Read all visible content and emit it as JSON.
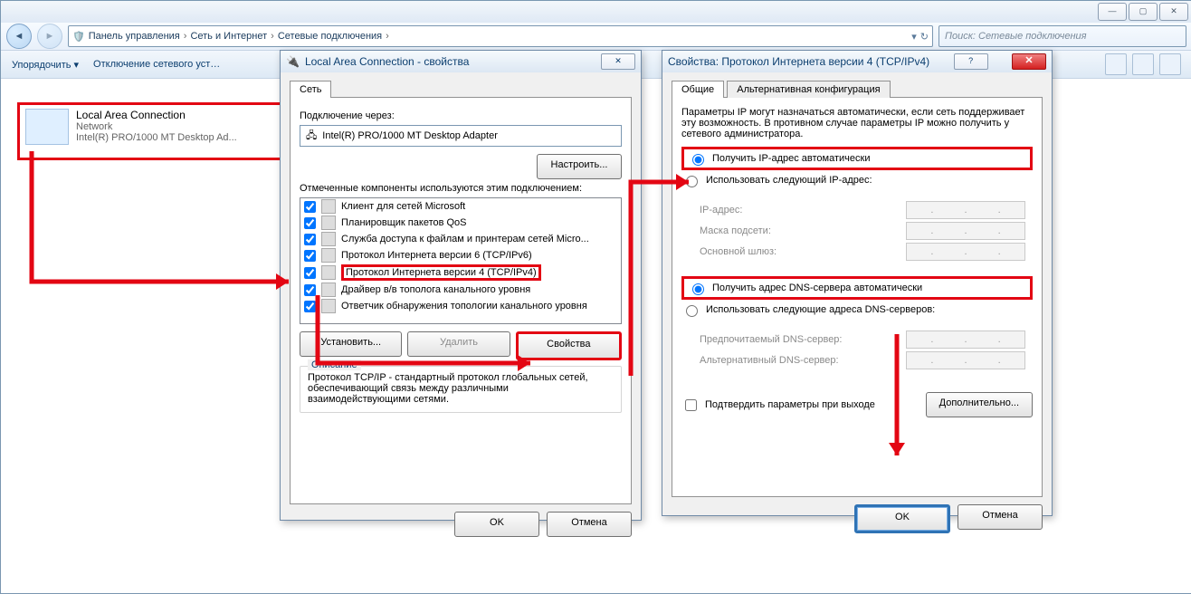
{
  "window": {
    "minimize": "—",
    "maximize": "▢",
    "close": "✕",
    "back": "◄",
    "forward": "►",
    "dropdown": "▾",
    "refresh": "↻"
  },
  "breadcrumb": {
    "b1": "Панель управления",
    "b2": "Сеть и Интернет",
    "b3": "Сетевые подключения",
    "sep": "›"
  },
  "search": {
    "placeholder": "Поиск: Сетевые подключения"
  },
  "toolbar": {
    "organize": "Упорядочить ▾",
    "disable": "Отключение сетевого уст…"
  },
  "connection": {
    "name": "Local Area Connection",
    "net": "Network",
    "adapter": "Intel(R) PRO/1000 MT Desktop Ad..."
  },
  "dlg1": {
    "title": "Local Area Connection - свойства",
    "tab_net": "Сеть",
    "connect_using": "Подключение через:",
    "adapter": "Intel(R) PRO/1000 MT Desktop Adapter",
    "configure": "Настроить...",
    "components_label": "Отмеченные компоненты используются этим подключением:",
    "components": [
      "Клиент для сетей Microsoft",
      "Планировщик пакетов QoS",
      "Служба доступа к файлам и принтерам сетей Micro...",
      "Протокол Интернета версии 6 (TCP/IPv6)",
      "Протокол Интернета версии 4 (TCP/IPv4)",
      "Драйвер в/в тополога канального уровня",
      "Ответчик обнаружения топологии канального уровня"
    ],
    "install": "Установить...",
    "uninstall": "Удалить",
    "properties": "Свойства",
    "desc_title": "Описание",
    "desc": "Протокол TCP/IP - стандартный протокол глобальных сетей, обеспечивающий связь между различными взаимодействующими сетями.",
    "ok": "OK",
    "cancel": "Отмена",
    "help": "?",
    "x": "✕"
  },
  "dlg2": {
    "title": "Свойства: Протокол Интернета версии 4 (TCP/IPv4)",
    "tab_general": "Общие",
    "tab_alt": "Альтернативная конфигурация",
    "intro": "Параметры IP могут назначаться автоматически, если сеть поддерживает эту возможность. В противном случае параметры IP можно получить у сетевого администратора.",
    "ip_auto": "Получить IP-адрес автоматически",
    "ip_manual": "Использовать следующий IP-адрес:",
    "ip_addr": "IP-адрес:",
    "mask": "Маска подсети:",
    "gateway": "Основной шлюз:",
    "dns_auto": "Получить адрес DNS-сервера автоматически",
    "dns_manual": "Использовать следующие адреса DNS-серверов:",
    "dns_pref": "Предпочитаемый DNS-сервер:",
    "dns_alt": "Альтернативный DNS-сервер:",
    "validate": "Подтвердить параметры при выходе",
    "advanced": "Дополнительно...",
    "ok": "OK",
    "cancel": "Отмена",
    "help": "?",
    "x": "✕",
    "dot": "."
  }
}
